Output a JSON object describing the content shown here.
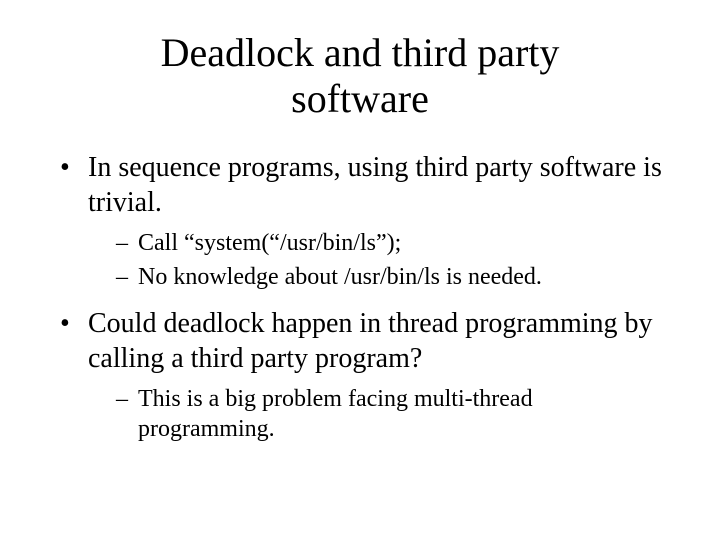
{
  "title": "Deadlock and third party software",
  "bullets": [
    {
      "text": "In sequence programs, using third party software is trivial.",
      "sub": [
        "Call “system(“/usr/bin/ls”);",
        "No knowledge about /usr/bin/ls is needed."
      ]
    },
    {
      "text": "Could deadlock happen in thread programming by calling a third party program?",
      "sub": [
        "This is a big problem facing multi-thread programming."
      ]
    }
  ]
}
